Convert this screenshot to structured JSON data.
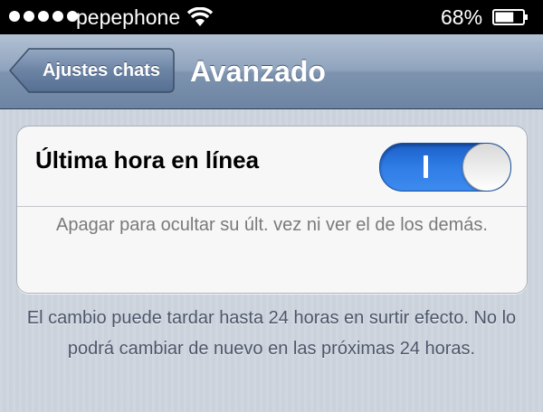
{
  "status_bar": {
    "carrier": "pepephone",
    "battery_percent": "68%",
    "battery_level": 0.68,
    "signal_bars": 5
  },
  "nav_bar": {
    "back_label": "Ajustes chats",
    "title": "Avanzado"
  },
  "settings": {
    "last_seen_label": "Última hora en línea",
    "last_seen_enabled": true,
    "last_seen_footnote": "Apagar para ocultar su últ. vez ni ver el de los demás."
  },
  "info_text": "El cambio puede tardar hasta 24 horas en surtir efecto. No lo podrá cambiar de nuevo en las próximas 24 horas.",
  "colors": {
    "toggle_on": "#2f7de6",
    "nav_bar": "#8ea3bd",
    "background": "#cbd2dc"
  }
}
